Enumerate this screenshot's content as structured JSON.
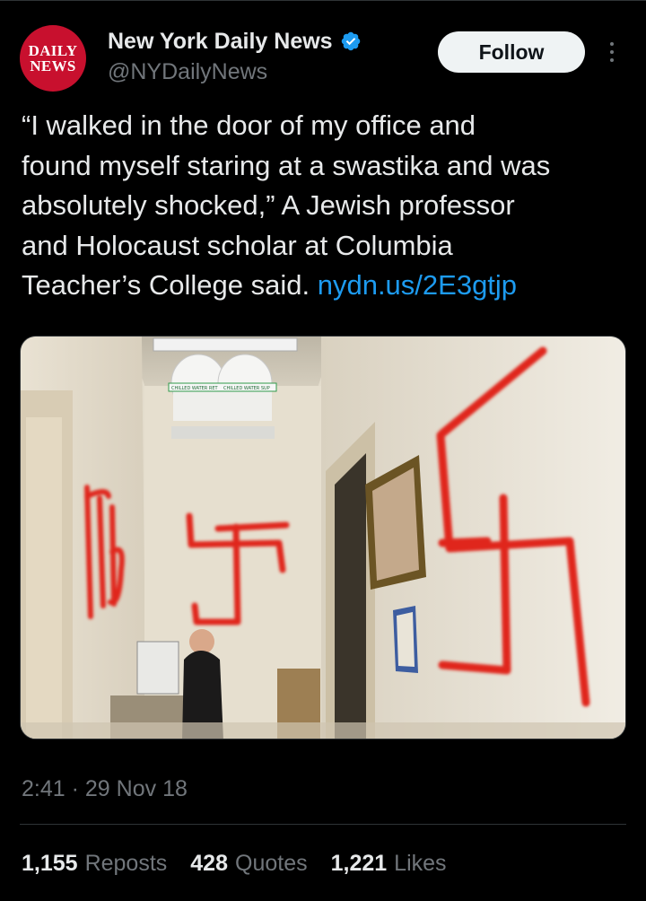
{
  "colors": {
    "background": "#000000",
    "text_primary": "#e7e9ea",
    "text_secondary": "#71767b",
    "link": "#1d9bf0",
    "verified_badge": "#1d9bf0",
    "avatar_bg": "#c8102e",
    "follow_bg": "#eff3f4",
    "graffiti_red": "#e0271f"
  },
  "author": {
    "avatar_line1": "DAILY",
    "avatar_line2": "NEWS",
    "display_name": "New York Daily News",
    "handle": "@NYDailyNews",
    "verified_icon": "verified-badge-icon",
    "follow_label": "Follow",
    "more_icon": "more-vertical-icon"
  },
  "tweet": {
    "text": "“I walked in the door of my office and\nfound myself staring at a swastika and was\nabsolutely shocked,” A Jewish professor\nand Holocaust scholar at Columbia\nTeacher’s College said. ",
    "link": "nydn.us/2E3gtjp"
  },
  "media": {
    "sign_left": "CHILLED WATER RET",
    "sign_right": "CHILLED WATER SUP"
  },
  "meta": {
    "time": "2:41",
    "separator": "·",
    "date": "29 Nov 18"
  },
  "stats": [
    {
      "value": "1,155",
      "label": "Reposts"
    },
    {
      "value": "428",
      "label": "Quotes"
    },
    {
      "value": "1,221",
      "label": "Likes"
    }
  ]
}
